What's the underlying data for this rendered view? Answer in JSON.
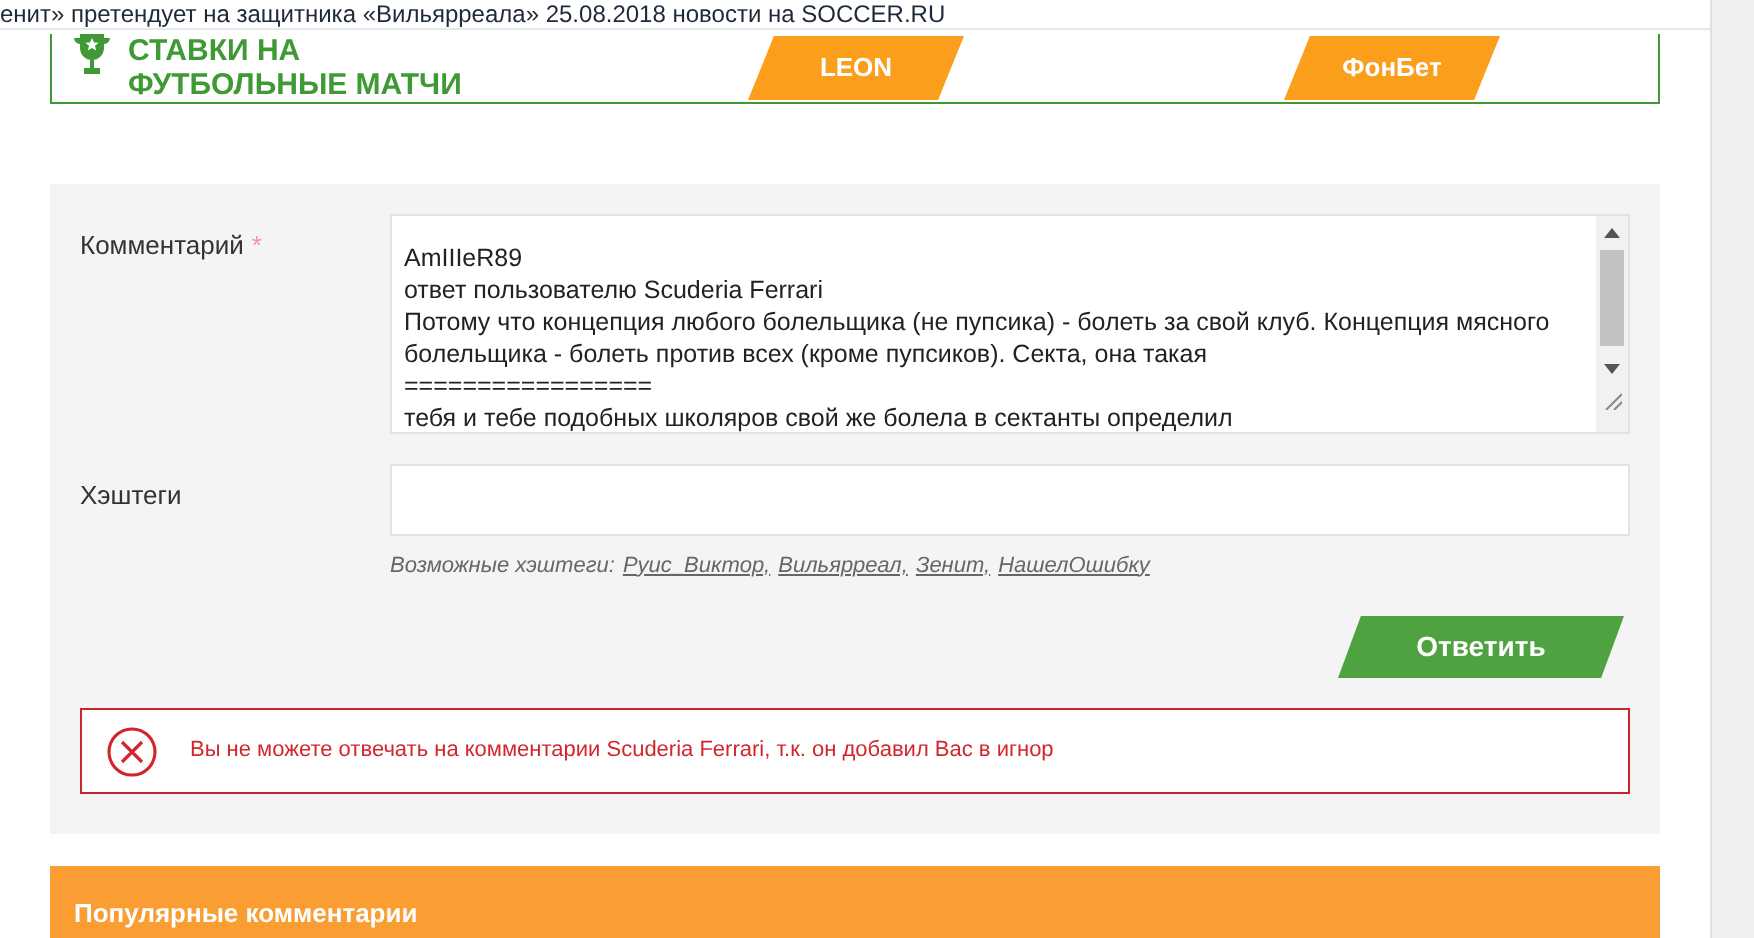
{
  "window": {
    "title": "енит» претендует на защитника «Вильярреала» 25.08.2018 новости на SOCCER.RU"
  },
  "banner": {
    "title_lines": [
      "СТАВКИ НА",
      "ФУТБОЛЬНЫЕ МАТЧИ"
    ],
    "bookmakers": [
      "LEON",
      "ФонБет"
    ]
  },
  "form": {
    "comment": {
      "label": "Комментарий",
      "required_mark": "*",
      "value": [
        "AmIIIeR89",
        "ответ пользователю Scuderia Ferrari",
        "Потому что концепция любого болельщика (не пупсика) - болеть за свой клуб. Концепция мясного болельщика - болеть против всех (кроме пупсиков). Секта, она такая",
        "=================",
        "тебя и тебе подобных школяров свой же болела в сектанты определил"
      ]
    },
    "hashtags": {
      "label": "Хэштеги",
      "hint": "Возможные хэштеги:",
      "suggestions": [
        "Руис_Виктор,",
        "Вильярреал,",
        "Зенит,",
        "НашелОшибку"
      ]
    },
    "submit": "Ответить",
    "error": "Вы не можете отвечать на комментарии Scuderia Ferrari, т.к. он добавил Вас в игнор"
  },
  "popular": {
    "title": "Популярные комментарии"
  }
}
